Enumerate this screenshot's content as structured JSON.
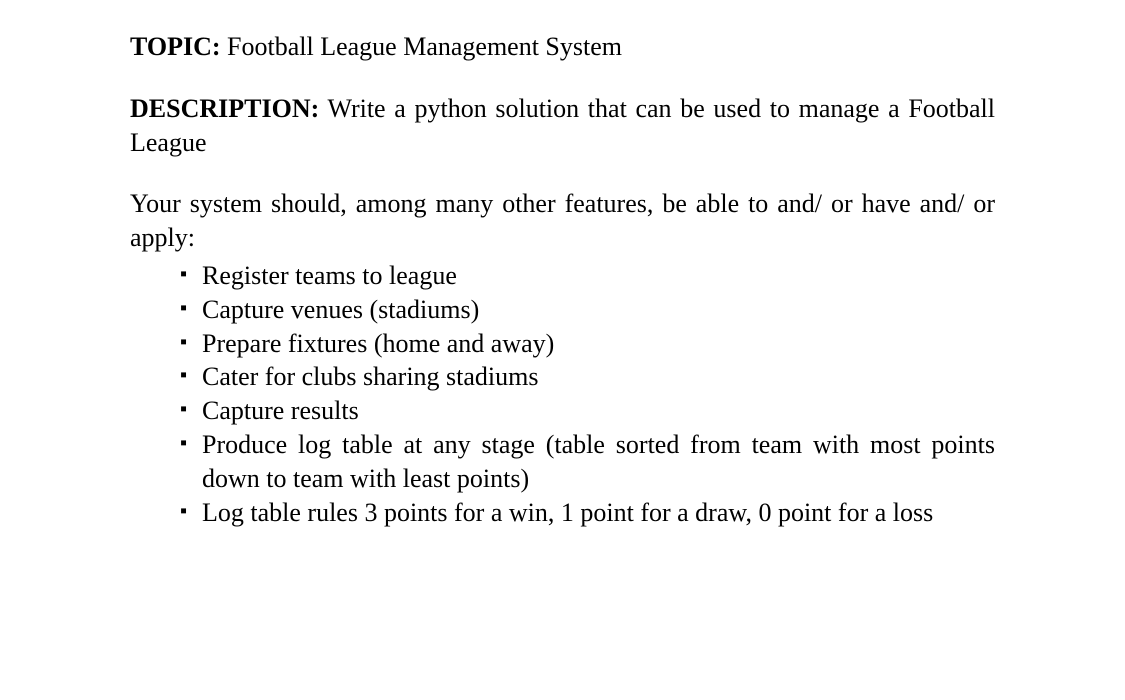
{
  "topic": {
    "label": "TOPIC:",
    "value": "Football League Management System"
  },
  "description": {
    "label": "DESCRIPTION:",
    "value": "Write a python solution that can be used to manage a Football League"
  },
  "features": {
    "intro": "Your system should, among many other features, be able to and/ or have and/ or apply:",
    "items": [
      "Register teams to league",
      "Capture venues (stadiums)",
      "Prepare fixtures (home and away)",
      "Cater for clubs sharing stadiums",
      "Capture results",
      "Produce log table at any stage (table sorted from team with most points down to team with least points)",
      "Log table rules 3 points for a win, 1 point for a draw, 0 point for a loss"
    ]
  }
}
